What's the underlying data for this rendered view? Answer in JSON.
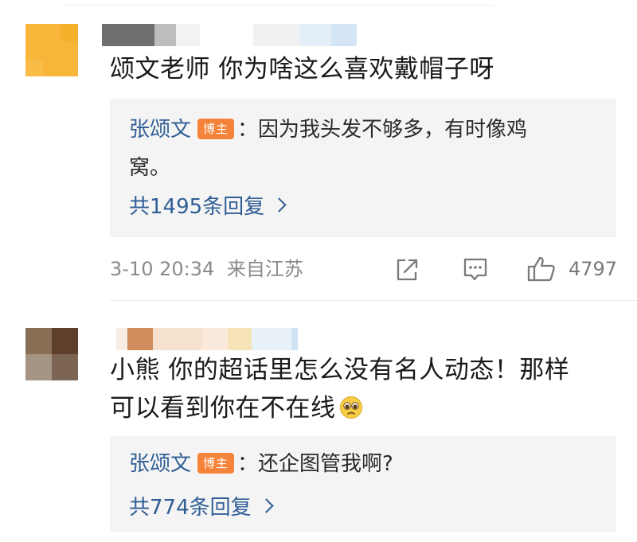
{
  "comments": [
    {
      "text": "颂文老师 你为啥这么喜欢戴帽子呀",
      "reply": {
        "author": "张颂文",
        "badge": "博主",
        "separator": "：",
        "line1": "因为我头发不够多，有时像鸡",
        "line2": "窝。"
      },
      "more_replies": "共1495条回复",
      "time": "3-10 20:34",
      "location": "来自江苏",
      "likes": "4797"
    },
    {
      "text_line1": "小熊 你的超话里怎么没有名人动态！那样",
      "text_line2": "可以看到你在不在线",
      "emoji": "pleading-face-emoji",
      "reply": {
        "author": "张颂文",
        "badge": "博主",
        "separator": "：",
        "line1": "还企图管我啊?"
      },
      "more_replies": "共774条回复"
    }
  ],
  "icons": {
    "share": "share-icon",
    "comment": "comment-icon",
    "like": "thumbs-up-icon",
    "chevron": "chevron-right-icon"
  },
  "colors": {
    "link_blue": "#2f5e96",
    "badge_orange": "#f5833a",
    "reply_bg": "#f4f4f4",
    "meta_gray": "#8a8a8a"
  }
}
